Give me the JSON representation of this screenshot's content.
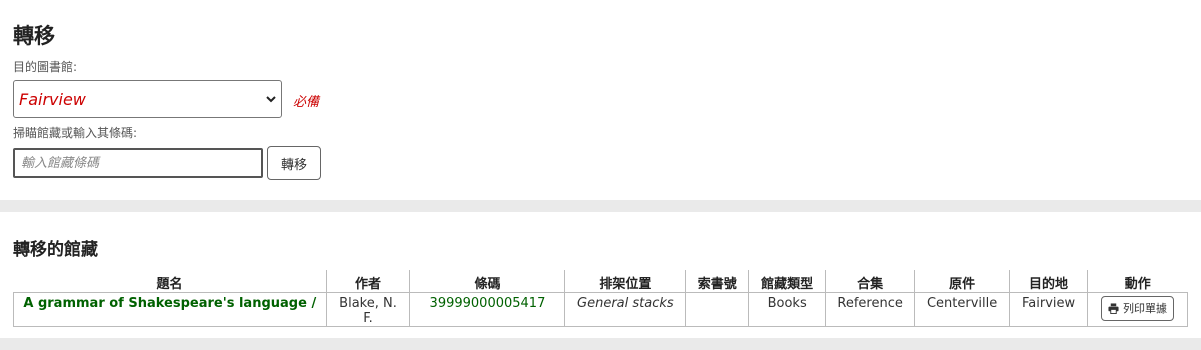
{
  "transfer": {
    "title": "轉移",
    "destination_label": "目的圖書館:",
    "destination_value": "Fairview",
    "required_text": "必備",
    "scan_label": "掃瞄館藏或輸入其條碼:",
    "barcode_placeholder": "輸入館藏條碼",
    "barcode_value": "",
    "transfer_button": "轉移"
  },
  "transferred": {
    "title": "轉移的館藏",
    "columns": [
      "題名",
      "作者",
      "條碼",
      "排架位置",
      "索書號",
      "館藏類型",
      "合集",
      "原件",
      "目的地",
      "動作"
    ],
    "rows": [
      {
        "title": "A grammar of Shakespeare's language /",
        "author": "Blake, N. F.",
        "barcode": "39999000005417",
        "shelving_location": "General stacks",
        "call_number": "",
        "item_type": "Books",
        "collection": "Reference",
        "origin": "Centerville",
        "destination": "Fairview",
        "action_label": "列印單據"
      }
    ]
  },
  "colors": {
    "accent_green": "#006100",
    "required_red": "#cc0000",
    "page_bg": "#eaeaea"
  },
  "icons": {
    "select_arrow": "chevron-down-icon",
    "print": "printer-icon"
  }
}
